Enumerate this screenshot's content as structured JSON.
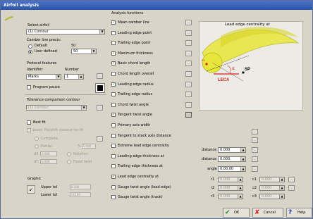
{
  "window": {
    "title": "Airfoil analysis"
  },
  "left": {
    "select_airfoil_label": "Select airfoil",
    "airfoil_value": "(1) Contour",
    "camber_title": "Camber line precis:",
    "default_label": "Default",
    "default_value": "50",
    "user_defined_label": "User defined",
    "user_defined_value": "50",
    "protocol_title": "Protocol features",
    "identifier_label": "Identifier",
    "identifier_value": "Marks",
    "number_label": "Number",
    "number_value": "1",
    "program_pause_label": "Program pause",
    "tolerance_title": "Tolerance comparison contour",
    "tolerance_value": "(1) Contour",
    "best_fit_label": "Best fit",
    "pivot_label": "pivot: Fix/shift contour for fit",
    "complete_label": "Complete",
    "partial_label": "Partial",
    "pct_label": "%",
    "pct_value": "0.000",
    "dx_label": "dX",
    "dy_label": "dY",
    "dx_value": "0.000",
    "dy_value": "0.000",
    "rotate_label": "Rotation",
    "fixed_label": "Fixed twist",
    "graphic_label": "Graphic",
    "upper_tol_label": "Upper tol",
    "lower_tol_label": "Lower tol",
    "upper_tol_value": "0.100",
    "lower_tol_value": "-0.100"
  },
  "functions_title": "Analysis functions",
  "functions": [
    {
      "label": "Mean camber line",
      "checked": true
    },
    {
      "label": "Leading edge point",
      "checked": false
    },
    {
      "label": "Trailing edge point",
      "checked": false
    },
    {
      "label": "Maximum thickness",
      "checked": true
    },
    {
      "label": "Basic chord length",
      "checked": true
    },
    {
      "label": "Chord length overall",
      "checked": false
    },
    {
      "label": "Leading edge radius",
      "checked": true
    },
    {
      "label": "Trailing edge radius",
      "checked": false
    },
    {
      "label": "Chord twist angle",
      "checked": false
    },
    {
      "label": "Tangent twist angle",
      "checked": true
    },
    {
      "label": "Primary axis width",
      "checked": false
    },
    {
      "label": "Tangent to stack axis distance",
      "checked": false
    },
    {
      "label": "Extreme lead edge centrality",
      "checked": false
    },
    {
      "label": "Leading edge thickness at",
      "checked": false
    },
    {
      "label": "Trailing edge thickness at",
      "checked": false
    },
    {
      "label": "Lead edge centrality at",
      "checked": true
    },
    {
      "label": "Gauge twist angle (lead edge)",
      "checked": false
    },
    {
      "label": "Gauge twist angle (track)",
      "checked": false
    }
  ],
  "preview": {
    "title": "Lead edge centrality at",
    "labels": {
      "sp": "SP",
      "leca": "LECA",
      "alpha": "α",
      "pt": "P1"
    },
    "colors": {
      "blade": "#e8e63a",
      "blade_edge": "#b8b520",
      "marker": "#d42020",
      "bg": "#ecebe6"
    }
  },
  "params": {
    "distance_label": "distance",
    "distance_value": "0.000",
    "distance2_label": "distance",
    "distance2_value": "0.000",
    "angle_label": "angle",
    "angle_value": "0.00.00",
    "r1_label": "r1",
    "r1_value": "0.000",
    "r2_label": "r2",
    "r2_value": "0.000",
    "r3_label": "r3",
    "r3_value": "0.000",
    "c1_label": "c1",
    "c1_value": "0.000",
    "c2_label": "c2",
    "c2_value": "0.000",
    "c3_label": "c3",
    "c3_value": "0.000"
  },
  "buttons": {
    "ok": "OK",
    "cancel": "Cancel",
    "help": "Help"
  }
}
